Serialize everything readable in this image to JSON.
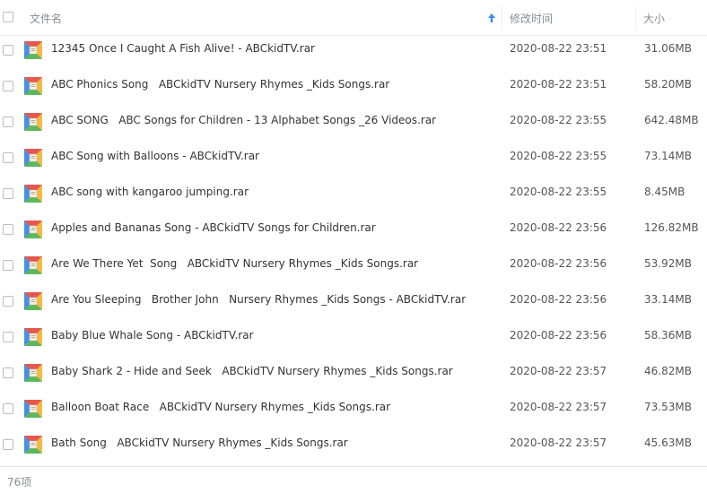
{
  "header": {
    "name_label": "文件名",
    "date_label": "修改时间",
    "size_label": "大小"
  },
  "files": [
    {
      "name": "12345 Once I Caught A Fish Alive! - ABCkidTV.rar",
      "date": "2020-08-22 23:51",
      "size": "31.06MB"
    },
    {
      "name": "ABC Phonics Song   ABCkidTV Nursery Rhymes _Kids Songs.rar",
      "date": "2020-08-22 23:51",
      "size": "58.20MB"
    },
    {
      "name": "ABC SONG   ABC Songs for Children - 13 Alphabet Songs _26 Videos.rar",
      "date": "2020-08-22 23:55",
      "size": "642.48MB"
    },
    {
      "name": "ABC Song with Balloons - ABCkidTV.rar",
      "date": "2020-08-22 23:55",
      "size": "73.14MB"
    },
    {
      "name": "ABC song with kangaroo jumping.rar",
      "date": "2020-08-22 23:55",
      "size": "8.45MB"
    },
    {
      "name": "Apples and Bananas Song - ABCkidTV Songs for Children.rar",
      "date": "2020-08-22 23:56",
      "size": "126.82MB"
    },
    {
      "name": "Are We There Yet  Song   ABCkidTV Nursery Rhymes _Kids Songs.rar",
      "date": "2020-08-22 23:56",
      "size": "53.92MB"
    },
    {
      "name": "Are You Sleeping   Brother John   Nursery Rhymes _Kids Songs - ABCkidTV.rar",
      "date": "2020-08-22 23:56",
      "size": "33.14MB"
    },
    {
      "name": "Baby Blue Whale Song - ABCkidTV.rar",
      "date": "2020-08-22 23:56",
      "size": "58.36MB"
    },
    {
      "name": "Baby Shark 2 - Hide and Seek   ABCkidTV Nursery Rhymes _Kids Songs.rar",
      "date": "2020-08-22 23:57",
      "size": "46.82MB"
    },
    {
      "name": "Balloon Boat Race   ABCkidTV Nursery Rhymes _Kids Songs.rar",
      "date": "2020-08-22 23:57",
      "size": "73.53MB"
    },
    {
      "name": "Bath Song   ABCkidTV Nursery Rhymes _Kids Songs.rar",
      "date": "2020-08-22 23:57",
      "size": "45.63MB"
    }
  ],
  "footer": {
    "count": "76项"
  },
  "icons": {
    "file": "rar-archive-icon",
    "sort": "sort-ascending-icon"
  },
  "colors": {
    "accent": "#3b8cff",
    "icon_top": "#e8574f",
    "icon_left": "#4a90e2",
    "icon_right": "#f5b942",
    "icon_bottom": "#5cb85c"
  }
}
